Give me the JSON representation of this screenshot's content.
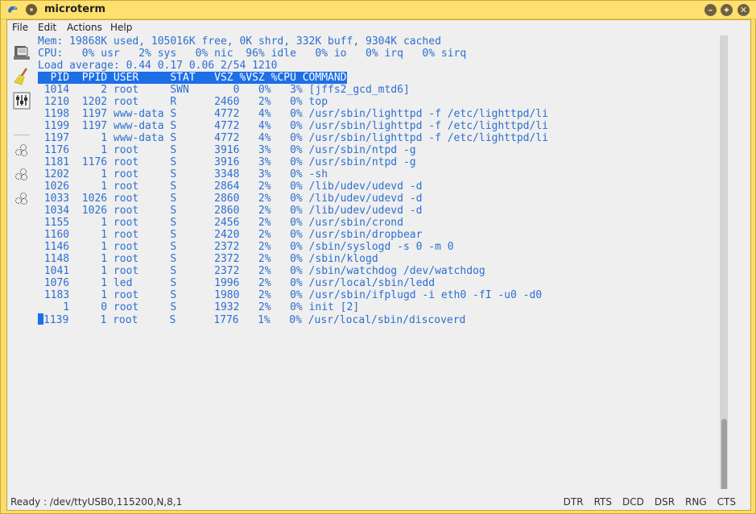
{
  "window": {
    "title": "microterm",
    "buttons": {
      "minimize": "–",
      "maximize": "⌖",
      "close": "✕"
    }
  },
  "menu": {
    "items": [
      {
        "label": "File"
      },
      {
        "label": "Edit"
      },
      {
        "label": "Actions"
      },
      {
        "label": "Help"
      }
    ]
  },
  "toolbar": {
    "tools": [
      {
        "name": "connect-port",
        "icon": "port-icon"
      },
      {
        "name": "clear-screen",
        "icon": "broom-icon"
      },
      {
        "name": "settings",
        "icon": "sliders-icon"
      },
      {
        "name": "macro-1",
        "icon": "gears-icon"
      },
      {
        "name": "macro-2",
        "icon": "gears-icon"
      },
      {
        "name": "macro-3",
        "icon": "gears-icon"
      }
    ]
  },
  "terminal": {
    "summary": [
      "Mem: 19868K used, 105016K free, 0K shrd, 332K buff, 9304K cached",
      "CPU:   0% usr   2% sys   0% nic  96% idle   0% io   0% irq   0% sirq",
      "Load average: 0.44 0.17 0.06 2/54 1210"
    ],
    "header": "  PID  PPID USER     STAT   VSZ %VSZ %CPU COMMAND",
    "processes": [
      {
        "pid": "1014",
        "ppid": "2",
        "user": "root",
        "stat": "SWN",
        "vsz": "0",
        "pvsz": "0%",
        "pcpu": "3%",
        "command": "[jffs2_gcd_mtd6]"
      },
      {
        "pid": "1210",
        "ppid": "1202",
        "user": "root",
        "stat": "R",
        "vsz": "2460",
        "pvsz": "2%",
        "pcpu": "0%",
        "command": "top"
      },
      {
        "pid": "1198",
        "ppid": "1197",
        "user": "www-data",
        "stat": "S",
        "vsz": "4772",
        "pvsz": "4%",
        "pcpu": "0%",
        "command": "/usr/sbin/lighttpd -f /etc/lighttpd/li"
      },
      {
        "pid": "1199",
        "ppid": "1197",
        "user": "www-data",
        "stat": "S",
        "vsz": "4772",
        "pvsz": "4%",
        "pcpu": "0%",
        "command": "/usr/sbin/lighttpd -f /etc/lighttpd/li"
      },
      {
        "pid": "1197",
        "ppid": "1",
        "user": "www-data",
        "stat": "S",
        "vsz": "4772",
        "pvsz": "4%",
        "pcpu": "0%",
        "command": "/usr/sbin/lighttpd -f /etc/lighttpd/li"
      },
      {
        "pid": "1176",
        "ppid": "1",
        "user": "root",
        "stat": "S",
        "vsz": "3916",
        "pvsz": "3%",
        "pcpu": "0%",
        "command": "/usr/sbin/ntpd -g"
      },
      {
        "pid": "1181",
        "ppid": "1176",
        "user": "root",
        "stat": "S",
        "vsz": "3916",
        "pvsz": "3%",
        "pcpu": "0%",
        "command": "/usr/sbin/ntpd -g"
      },
      {
        "pid": "1202",
        "ppid": "1",
        "user": "root",
        "stat": "S",
        "vsz": "3348",
        "pvsz": "3%",
        "pcpu": "0%",
        "command": "-sh"
      },
      {
        "pid": "1026",
        "ppid": "1",
        "user": "root",
        "stat": "S",
        "vsz": "2864",
        "pvsz": "2%",
        "pcpu": "0%",
        "command": "/lib/udev/udevd -d"
      },
      {
        "pid": "1033",
        "ppid": "1026",
        "user": "root",
        "stat": "S",
        "vsz": "2860",
        "pvsz": "2%",
        "pcpu": "0%",
        "command": "/lib/udev/udevd -d"
      },
      {
        "pid": "1034",
        "ppid": "1026",
        "user": "root",
        "stat": "S",
        "vsz": "2860",
        "pvsz": "2%",
        "pcpu": "0%",
        "command": "/lib/udev/udevd -d"
      },
      {
        "pid": "1155",
        "ppid": "1",
        "user": "root",
        "stat": "S",
        "vsz": "2456",
        "pvsz": "2%",
        "pcpu": "0%",
        "command": "/usr/sbin/crond"
      },
      {
        "pid": "1160",
        "ppid": "1",
        "user": "root",
        "stat": "S",
        "vsz": "2420",
        "pvsz": "2%",
        "pcpu": "0%",
        "command": "/usr/sbin/dropbear"
      },
      {
        "pid": "1146",
        "ppid": "1",
        "user": "root",
        "stat": "S",
        "vsz": "2372",
        "pvsz": "2%",
        "pcpu": "0%",
        "command": "/sbin/syslogd -s 0 -m 0"
      },
      {
        "pid": "1148",
        "ppid": "1",
        "user": "root",
        "stat": "S",
        "vsz": "2372",
        "pvsz": "2%",
        "pcpu": "0%",
        "command": "/sbin/klogd"
      },
      {
        "pid": "1041",
        "ppid": "1",
        "user": "root",
        "stat": "S",
        "vsz": "2372",
        "pvsz": "2%",
        "pcpu": "0%",
        "command": "/sbin/watchdog /dev/watchdog"
      },
      {
        "pid": "1076",
        "ppid": "1",
        "user": "led",
        "stat": "S",
        "vsz": "1996",
        "pvsz": "2%",
        "pcpu": "0%",
        "command": "/usr/local/sbin/ledd"
      },
      {
        "pid": "1183",
        "ppid": "1",
        "user": "root",
        "stat": "S",
        "vsz": "1980",
        "pvsz": "2%",
        "pcpu": "0%",
        "command": "/usr/sbin/ifplugd -i eth0 -fI -u0 -d0"
      },
      {
        "pid": "1",
        "ppid": "0",
        "user": "root",
        "stat": "S",
        "vsz": "1932",
        "pvsz": "2%",
        "pcpu": "0%",
        "command": "init [2]"
      },
      {
        "pid": "1139",
        "ppid": "1",
        "user": "root",
        "stat": "S",
        "vsz": "1776",
        "pvsz": "1%",
        "pcpu": "0%",
        "command": "/usr/local/sbin/discoverd"
      }
    ]
  },
  "status": {
    "text": "Ready : /dev/ttyUSB0,115200,N,8,1",
    "signals": [
      "DTR",
      "RTS",
      "DCD",
      "DSR",
      "RNG",
      "CTS"
    ]
  },
  "colors": {
    "terminal_text": "#2c6fd0",
    "header_bg": "#1d6fe6",
    "window_frame": "#fcdc6a"
  }
}
